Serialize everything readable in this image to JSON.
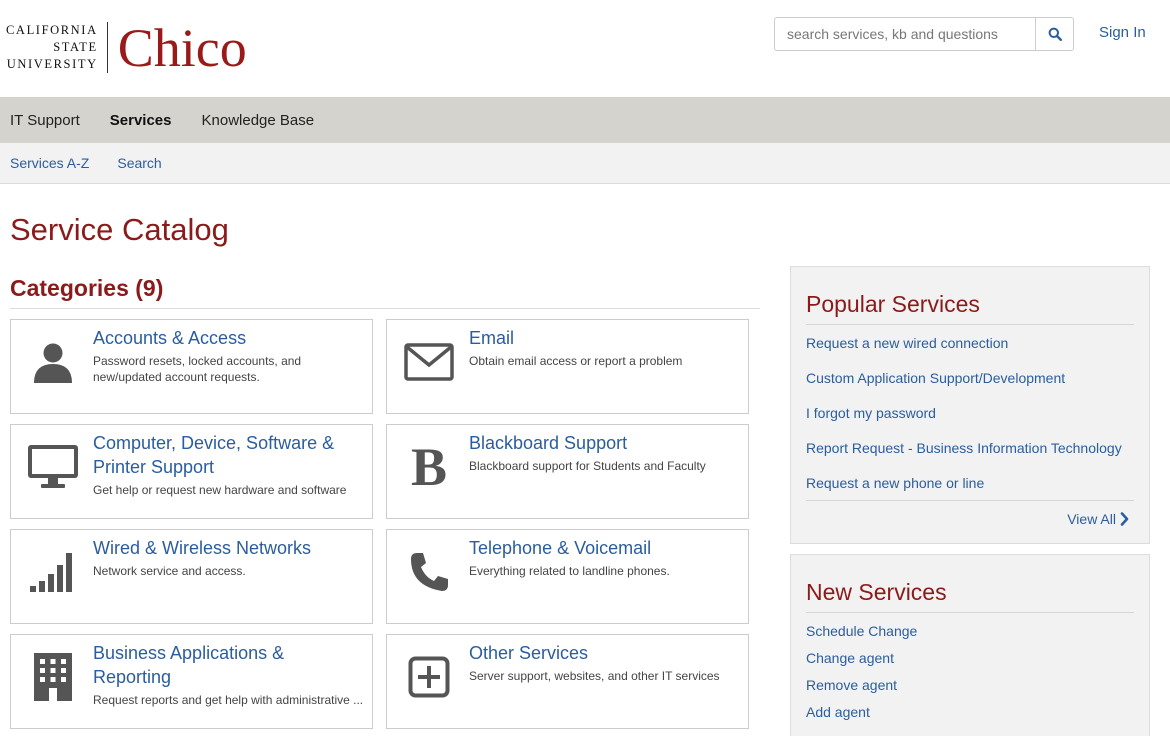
{
  "header": {
    "logo_csu_line1": "CALIFORNIA",
    "logo_csu_line2": "STATE",
    "logo_csu_line3": "UNIVERSITY",
    "logo_chico": "Chico",
    "search_placeholder": "search services, kb and questions",
    "search_icon": "search-icon",
    "signin_label": "Sign In"
  },
  "nav": {
    "items": [
      {
        "label": "IT Support",
        "active": false
      },
      {
        "label": "Services",
        "active": true
      },
      {
        "label": "Knowledge Base",
        "active": false
      }
    ]
  },
  "subnav": {
    "items": [
      {
        "label": "Services A-Z"
      },
      {
        "label": "Search"
      }
    ]
  },
  "main": {
    "page_title": "Service Catalog",
    "categories_heading": "Categories (9)",
    "categories": [
      {
        "title": "Accounts & Access",
        "desc": "Password resets, locked accounts, and new/updated account requests.",
        "icon": "user-icon"
      },
      {
        "title": "Email",
        "desc": "Obtain email access or report a problem",
        "icon": "envelope-icon"
      },
      {
        "title": "Computer, Device, Software & Printer Support",
        "desc": "Get help or request new hardware and software",
        "icon": "monitor-icon"
      },
      {
        "title": "Blackboard Support",
        "desc": "Blackboard support for Students and Faculty",
        "icon": "blackboard-b-icon"
      },
      {
        "title": "Wired & Wireless Networks",
        "desc": "Network service and access.",
        "icon": "signal-bars-icon"
      },
      {
        "title": "Telephone & Voicemail",
        "desc": "Everything related to landline phones.",
        "icon": "phone-icon"
      },
      {
        "title": "Business Applications & Reporting",
        "desc": "Request reports and get help with administrative ...",
        "icon": "building-icon"
      },
      {
        "title": "Other Services",
        "desc": "Server support, websites, and other IT services",
        "icon": "plus-square-icon"
      }
    ]
  },
  "sidebar": {
    "popular": {
      "title": "Popular Services",
      "links": [
        "Request a new wired connection",
        "Custom Application Support/Development",
        "I forgot my password",
        "Report Request - Business Information Technology",
        "Request a new phone or line"
      ],
      "view_all": "View All"
    },
    "new_services": {
      "title": "New Services",
      "links": [
        "Schedule Change",
        "Change agent",
        "Remove agent",
        "Add agent"
      ]
    }
  },
  "colors": {
    "brand_red": "#8b1a1a",
    "link_blue": "#2a5d9f",
    "nav_bg": "#d5d3ce",
    "icon_gray": "#555555"
  }
}
